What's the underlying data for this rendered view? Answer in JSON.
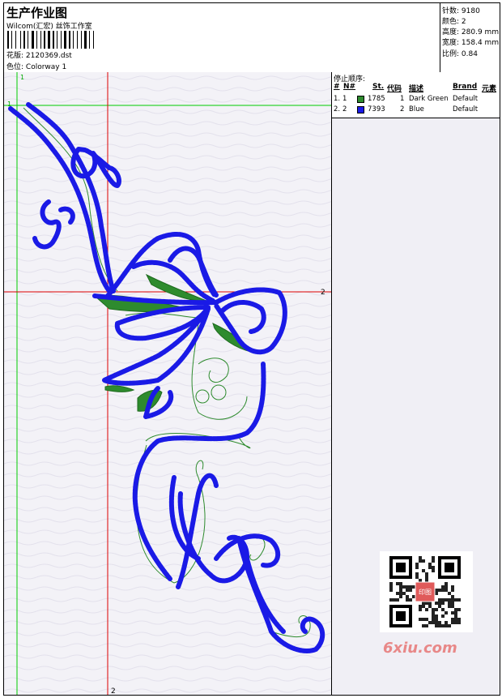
{
  "header": {
    "title": "生产作业图",
    "company": "Wilcom(汇宏) 丝饰工作室",
    "design_file_label": "花版:",
    "design_file": "2120369.dst",
    "colorway_label": "色位:",
    "colorway": "Colorway 1"
  },
  "stats": {
    "stitches_label": "针数:",
    "stitches": "9180",
    "colors_label": "颜色:",
    "colors": "2",
    "height_label": "高度:",
    "height": "280.9 mm",
    "width_label": "宽度:",
    "width": "158.4 mm",
    "ratio_label": "比例:",
    "ratio": "0.84"
  },
  "stop_sequence": {
    "title": "停止顺序:",
    "columns": [
      "#",
      "N#",
      "St.",
      "代码",
      "描述",
      "Brand",
      "元素"
    ],
    "rows": [
      {
        "index": "1.",
        "needle": "1",
        "color": "#2e8b2e",
        "stitches": "1785",
        "code": "1",
        "description": "Dark Green",
        "brand": "Default"
      },
      {
        "index": "2.",
        "needle": "2",
        "color": "#1a1ae6",
        "stitches": "7393",
        "code": "2",
        "description": "Blue",
        "brand": "Default"
      }
    ]
  },
  "guides": {
    "green_v_label": "1",
    "green_h_label": "1",
    "red_h_label": "2",
    "red_v_label": "2"
  },
  "watermark": {
    "site": "6xiu.com",
    "seal_text": "印图"
  },
  "colors": {
    "thread_green": "#2e8b2e",
    "thread_blue": "#1a1ae6",
    "guide_green": "#00cc00",
    "guide_red": "#dd0000"
  }
}
